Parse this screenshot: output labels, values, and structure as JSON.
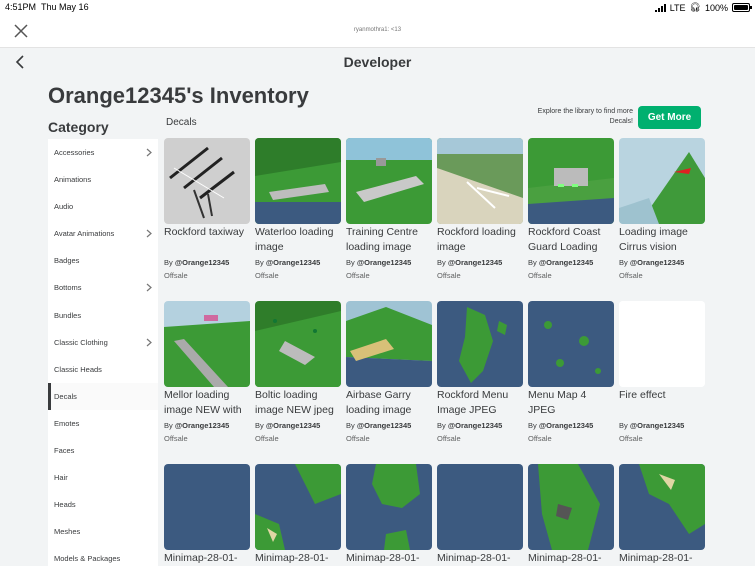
{
  "status_bar": {
    "time": "4:51PM",
    "date": "Thu May 16",
    "network": "LTE",
    "battery": "100%"
  },
  "browser": {
    "url": "ryanmothra1: <13"
  },
  "nav": {
    "title": "Developer"
  },
  "page": {
    "inventory_title": "Orange12345's Inventory",
    "category_heading": "Category",
    "section_label": "Decals"
  },
  "promo": {
    "text": "Explore the library to find more Decals!",
    "button_label": "Get More"
  },
  "sidebar": {
    "items": [
      {
        "label": "Accessories",
        "chevron": true
      },
      {
        "label": "Animations",
        "chevron": false
      },
      {
        "label": "Audio",
        "chevron": false
      },
      {
        "label": "Avatar Animations",
        "chevron": true
      },
      {
        "label": "Badges",
        "chevron": false
      },
      {
        "label": "Bottoms",
        "chevron": true
      },
      {
        "label": "Bundles",
        "chevron": false
      },
      {
        "label": "Classic Clothing",
        "chevron": true
      },
      {
        "label": "Classic Heads",
        "chevron": false
      },
      {
        "label": "Decals",
        "chevron": false,
        "active": true
      },
      {
        "label": "Emotes",
        "chevron": false
      },
      {
        "label": "Faces",
        "chevron": false
      },
      {
        "label": "Hair",
        "chevron": false
      },
      {
        "label": "Heads",
        "chevron": false
      },
      {
        "label": "Meshes",
        "chevron": false
      },
      {
        "label": "Models & Packages",
        "chevron": false
      }
    ]
  },
  "items": [
    {
      "name": "Rockford taxiway",
      "creator_prefix": "By",
      "creator": "@Orange12345",
      "price": "Offsale",
      "thumb": "taxiway"
    },
    {
      "name": "Waterloo loading image",
      "creator_prefix": "By",
      "creator": "@Orange12345",
      "price": "Offsale",
      "thumb": "waterloo"
    },
    {
      "name": "Training Centre loading image",
      "creator_prefix": "By",
      "creator": "@Orange12345",
      "price": "Offsale",
      "thumb": "training"
    },
    {
      "name": "Rockford loading image",
      "creator_prefix": "By",
      "creator": "@Orange12345",
      "price": "Offsale",
      "thumb": "rockford"
    },
    {
      "name": "Rockford Coast Guard Loading",
      "creator_prefix": "By",
      "creator": "@Orange12345",
      "price": "Offsale",
      "thumb": "coastguard"
    },
    {
      "name": "Loading image Cirrus vision",
      "creator_prefix": "By",
      "creator": "@Orange12345",
      "price": "Offsale",
      "thumb": "cirrus"
    },
    {
      "name": "Mellor loading image NEW with",
      "creator_prefix": "By",
      "creator": "@Orange12345",
      "price": "Offsale",
      "thumb": "mellor"
    },
    {
      "name": "Boltic loading image NEW jpeg",
      "creator_prefix": "By",
      "creator": "@Orange12345",
      "price": "Offsale",
      "thumb": "boltic"
    },
    {
      "name": "Airbase Garry loading image",
      "creator_prefix": "By",
      "creator": "@Orange12345",
      "price": "Offsale",
      "thumb": "garry"
    },
    {
      "name": "Rockford Menu Image JPEG",
      "creator_prefix": "By",
      "creator": "@Orange12345",
      "price": "Offsale",
      "thumb": "menu"
    },
    {
      "name": "Menu Map 4 JPEG",
      "creator_prefix": "By",
      "creator": "@Orange12345",
      "price": "Offsale",
      "thumb": "menumap"
    },
    {
      "name": "Fire effect",
      "creator_prefix": "By",
      "creator": "@Orange12345",
      "price": "Offsale",
      "thumb": "blank"
    },
    {
      "name": "Minimap-28-01-",
      "thumb": "mini-empty"
    },
    {
      "name": "Minimap-28-01-",
      "thumb": "mini-a"
    },
    {
      "name": "Minimap-28-01-",
      "thumb": "mini-b"
    },
    {
      "name": "Minimap-28-01-",
      "thumb": "mini-empty"
    },
    {
      "name": "Minimap-28-01-",
      "thumb": "mini-c"
    },
    {
      "name": "Minimap-28-01-",
      "thumb": "mini-d"
    }
  ],
  "colors": {
    "accent_green": "#00b06f",
    "text": "#393b3d",
    "ocean": "#3c5a80",
    "grass": "#3c9a36"
  }
}
